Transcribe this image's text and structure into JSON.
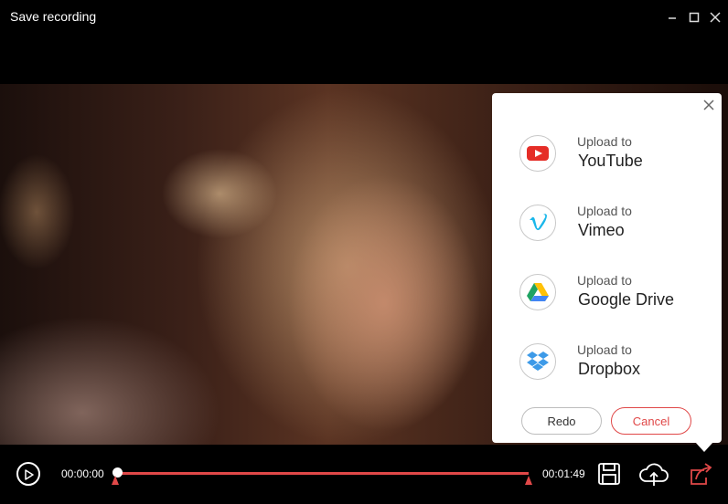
{
  "window": {
    "title": "Save recording"
  },
  "player": {
    "current_time": "00:00:00",
    "duration": "00:01:49",
    "progress": 0.0
  },
  "upload_panel": {
    "items": [
      {
        "small": "Upload to",
        "name": "YouTube",
        "icon": "youtube-icon"
      },
      {
        "small": "Upload to",
        "name": "Vimeo",
        "icon": "vimeo-icon"
      },
      {
        "small": "Upload to",
        "name": "Google Drive",
        "icon": "google-drive-icon"
      },
      {
        "small": "Upload to",
        "name": "Dropbox",
        "icon": "dropbox-icon"
      }
    ],
    "redo_label": "Redo",
    "cancel_label": "Cancel"
  },
  "colors": {
    "accent": "#e04848",
    "youtube": "#e52d27",
    "vimeo": "#1ab7ea",
    "dropbox": "#3d9ae8"
  }
}
